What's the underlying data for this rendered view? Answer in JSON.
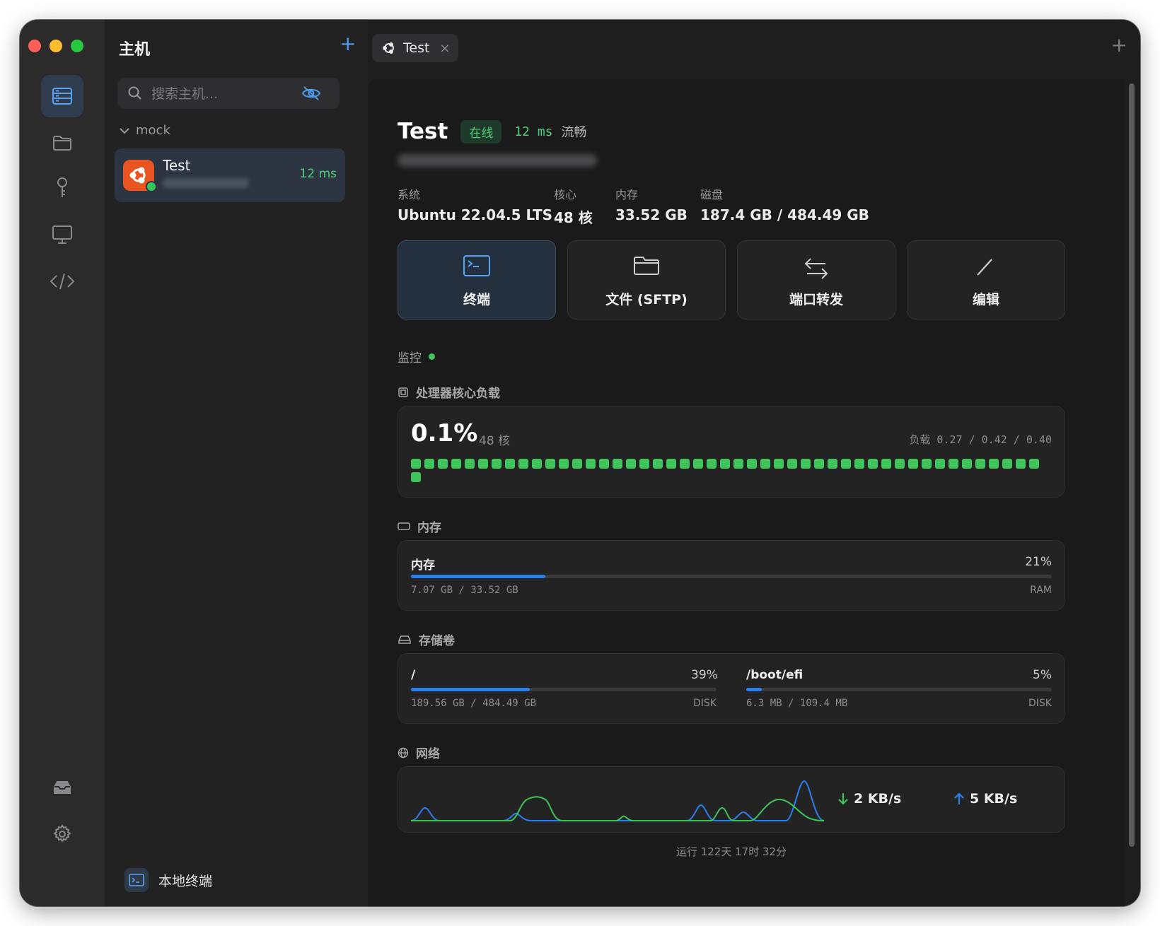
{
  "sidebar": {
    "title": "主机",
    "search": {
      "placeholder": "搜索主机...",
      "value": ""
    },
    "group": "mock",
    "host": {
      "name": "Test",
      "latency": "12 ms"
    },
    "local_terminal": "本地终端"
  },
  "tabs": [
    {
      "label": "Test",
      "close": "×"
    }
  ],
  "host": {
    "title": "Test",
    "status": "在线",
    "latency": "12 ms",
    "quality": "流畅",
    "specs": [
      {
        "label": "系统",
        "value": "Ubuntu 22.04.5 LTS"
      },
      {
        "label": "核心",
        "value": "48 核"
      },
      {
        "label": "内存",
        "value": "33.52 GB"
      },
      {
        "label": "磁盘",
        "value": "187.4 GB / 484.49 GB"
      }
    ]
  },
  "actions": [
    {
      "label": "终端",
      "icon": "terminal-icon"
    },
    {
      "label": "文件 (SFTP)",
      "icon": "folder-icon"
    },
    {
      "label": "端口转发",
      "icon": "arrows-swap-icon"
    },
    {
      "label": "编辑",
      "icon": "pencil-icon"
    }
  ],
  "monitor": {
    "title": "监控",
    "cpu": {
      "section": "处理器核心负载",
      "usage": "0.1%",
      "cores_label": "48 核",
      "load": "负载 0.27 / 0.42 / 0.40",
      "core_count": 48
    },
    "memory": {
      "section": "内存",
      "label": "内存",
      "percent_text": "21%",
      "fraction": 0.21,
      "detail": "7.07 GB / 33.52 GB",
      "tag": "RAM"
    },
    "storage": {
      "section": "存储卷",
      "volumes": [
        {
          "mount": "/",
          "percent_text": "39%",
          "fraction": 0.39,
          "detail": "189.56 GB / 484.49 GB",
          "tag": "DISK"
        },
        {
          "mount": "/boot/efi",
          "percent_text": "5%",
          "fraction": 0.05,
          "detail": "6.3 MB / 109.4 MB",
          "tag": "DISK"
        }
      ]
    },
    "network": {
      "section": "网络",
      "download": "2 KB/s",
      "upload": "5 KB/s"
    },
    "uptime": "运行 122天 17时 32分"
  },
  "colors": {
    "accent": "#2a7fef",
    "online": "#4fd17a",
    "core": "#3fc55a",
    "ubuntu": "#e95420"
  }
}
